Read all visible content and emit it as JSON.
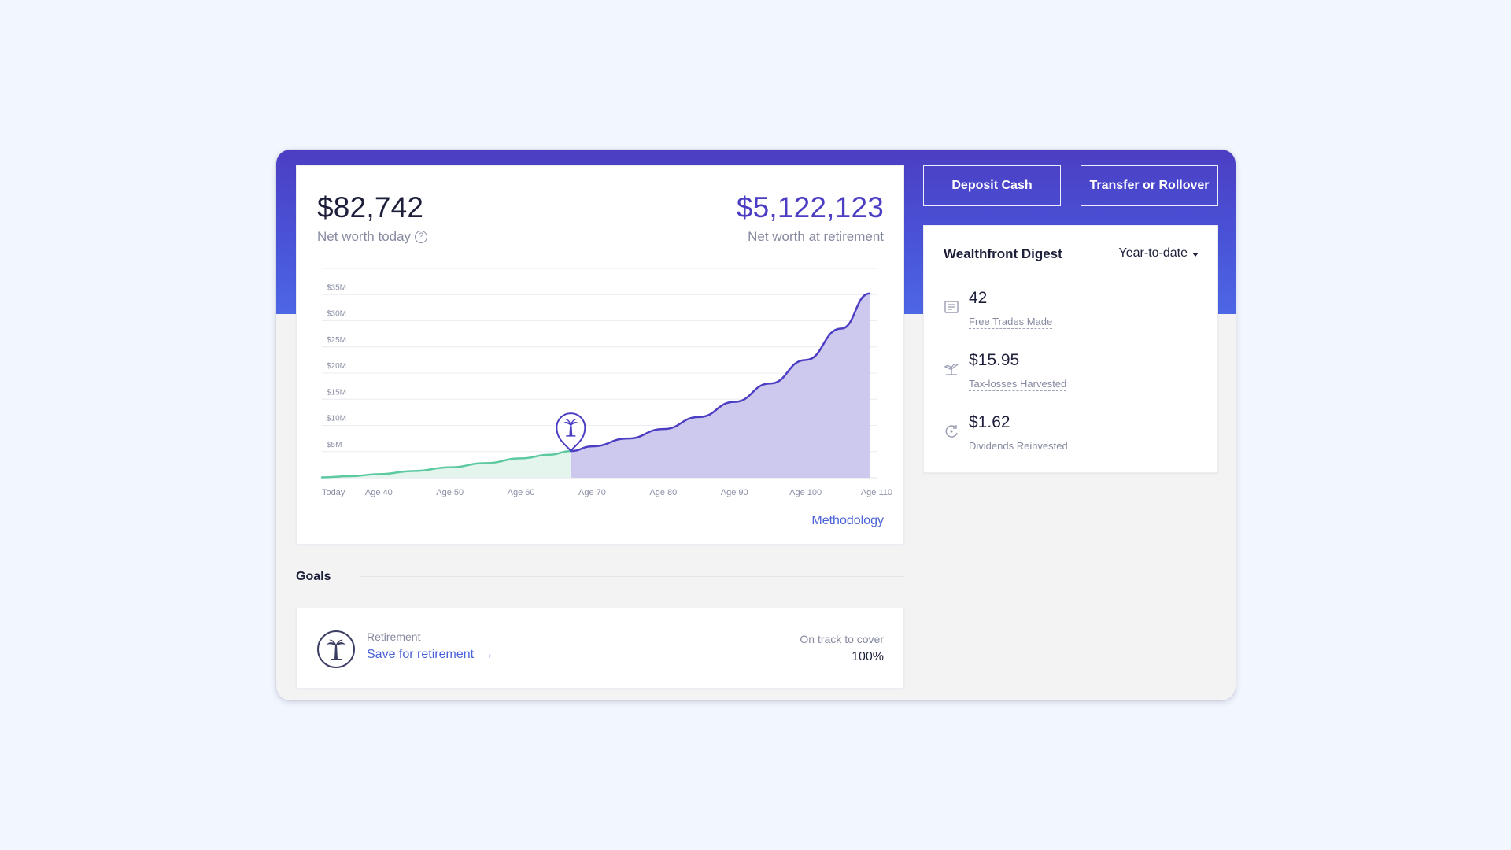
{
  "net_worth": {
    "today_value": "$82,742",
    "today_label": "Net worth today",
    "help_glyph": "?",
    "retirement_value": "$5,122,123",
    "retirement_label": "Net worth at retirement",
    "methodology_link": "Methodology"
  },
  "chart_data": {
    "type": "area",
    "title": "",
    "xlabel": "",
    "ylabel": "",
    "x_tick_labels": [
      "Today",
      "Age 40",
      "Age 50",
      "Age 60",
      "Age 70",
      "Age 80",
      "Age 90",
      "Age 100",
      "Age 110"
    ],
    "y_tick_labels": [
      "$5M",
      "$10M",
      "$15M",
      "$20M",
      "$25M",
      "$30M",
      "$35M"
    ],
    "y_ticks": [
      5,
      10,
      15,
      20,
      25,
      30,
      35
    ],
    "y_unit": "$M",
    "x_ticks": [
      32,
      40,
      50,
      60,
      70,
      80,
      90,
      100,
      110
    ],
    "xlim": [
      32,
      110
    ],
    "ylim": [
      0,
      40
    ],
    "grid": true,
    "retirement_age": 67,
    "retirement_marker_icon": "palm-tree-icon",
    "series": [
      {
        "segment": "pre-retirement",
        "color": "#5cc9a0",
        "fill": "#e4f5ee",
        "points": [
          [
            32,
            0.08
          ],
          [
            36,
            0.3
          ],
          [
            40,
            0.7
          ],
          [
            45,
            1.3
          ],
          [
            50,
            2.0
          ],
          [
            55,
            2.8
          ],
          [
            60,
            3.7
          ],
          [
            64,
            4.4
          ],
          [
            67,
            5.1
          ]
        ]
      },
      {
        "segment": "post-retirement",
        "color": "#4b3ec3",
        "fill": "#cdc9ee",
        "points": [
          [
            67,
            5.1
          ],
          [
            70,
            6.0
          ],
          [
            75,
            7.5
          ],
          [
            80,
            9.3
          ],
          [
            85,
            11.6
          ],
          [
            90,
            14.5
          ],
          [
            95,
            18.0
          ],
          [
            100,
            22.5
          ],
          [
            105,
            28.5
          ],
          [
            109,
            35.2
          ]
        ]
      }
    ]
  },
  "actions": {
    "deposit": "Deposit Cash",
    "transfer": "Transfer or Rollover"
  },
  "digest": {
    "title": "Wealthfront Digest",
    "period": "Year-to-date",
    "items": [
      {
        "value": "42",
        "label": "Free Trades Made",
        "icon": "receipt-icon"
      },
      {
        "value": "$15.95",
        "label": "Tax-losses Harvested",
        "icon": "harvest-icon"
      },
      {
        "value": "$1.62",
        "label": "Dividends Reinvested",
        "icon": "reinvest-icon"
      }
    ]
  },
  "goals": {
    "section_label": "Goals",
    "items": [
      {
        "icon": "palm-tree-icon",
        "category": "Retirement",
        "link": "Save for retirement",
        "arrow": "→",
        "status_label": "On track to cover",
        "status_value": "100%"
      }
    ]
  },
  "colors": {
    "accent": "#4b3ec3",
    "link": "#4a62d8",
    "header_gradient_top": "#4b3ec3",
    "header_gradient_bottom": "#4c67e6",
    "muted_text": "#868aa0"
  }
}
